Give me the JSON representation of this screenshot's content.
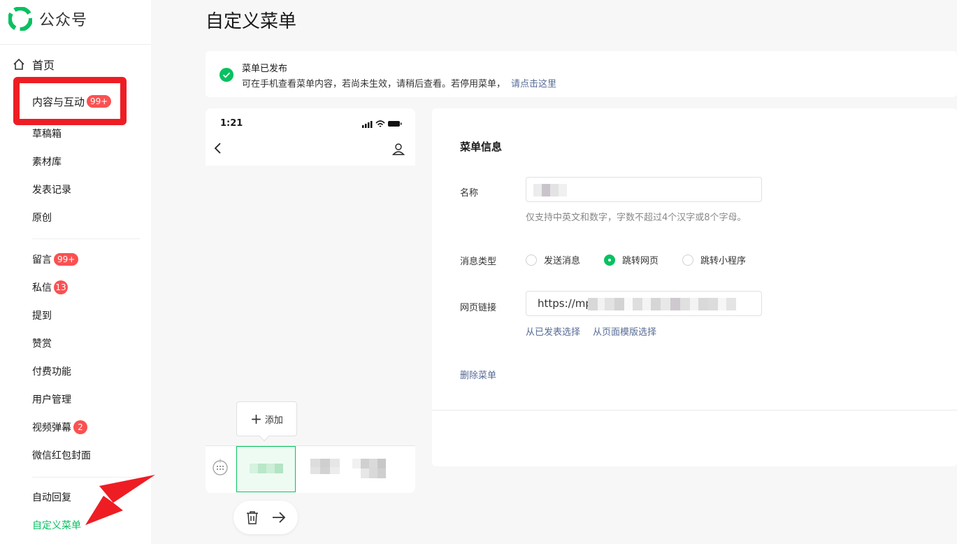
{
  "app": {
    "logo_text": "公众号",
    "home_label": "首页"
  },
  "sidebar": {
    "items": [
      {
        "label": "内容与互动",
        "badge": "99+"
      },
      {
        "label": "草稿箱"
      },
      {
        "label": "素材库"
      },
      {
        "label": "发表记录"
      },
      {
        "label": "原创"
      },
      {
        "label": "留言",
        "badge": "99+"
      },
      {
        "label": "私信",
        "badge": "13"
      },
      {
        "label": "提到"
      },
      {
        "label": "赞赏"
      },
      {
        "label": "付费功能"
      },
      {
        "label": "用户管理"
      },
      {
        "label": "视频弹幕",
        "badge": "2"
      },
      {
        "label": "微信红包封面"
      },
      {
        "label": "自动回复"
      },
      {
        "label": "自定义菜单"
      }
    ]
  },
  "page": {
    "title": "自定义菜单"
  },
  "notice": {
    "title": "菜单已发布",
    "body": "可在手机查看菜单内容，若尚未生效，请稍后查看。若停用菜单，",
    "link": "请点击这里"
  },
  "phone": {
    "time": "1:21",
    "add_label": "添加"
  },
  "form": {
    "title": "菜单信息",
    "name_label": "名称",
    "name_hint": "仅支持中英文和数字，字数不超过4个汉字或8个字母。",
    "type_label": "消息类型",
    "options": [
      "发送消息",
      "跳转网页",
      "跳转小程序"
    ],
    "selected_option": "跳转网页",
    "url_label": "网页链接",
    "url_value": "https://mp",
    "choose_published": "从已发表选择",
    "choose_template": "从页面模版选择",
    "delete_menu": "删除菜单"
  },
  "colors": {
    "accent": "#07c160",
    "badge": "#fa5151",
    "link": "#576b95",
    "highlight": "#ee1d24"
  }
}
